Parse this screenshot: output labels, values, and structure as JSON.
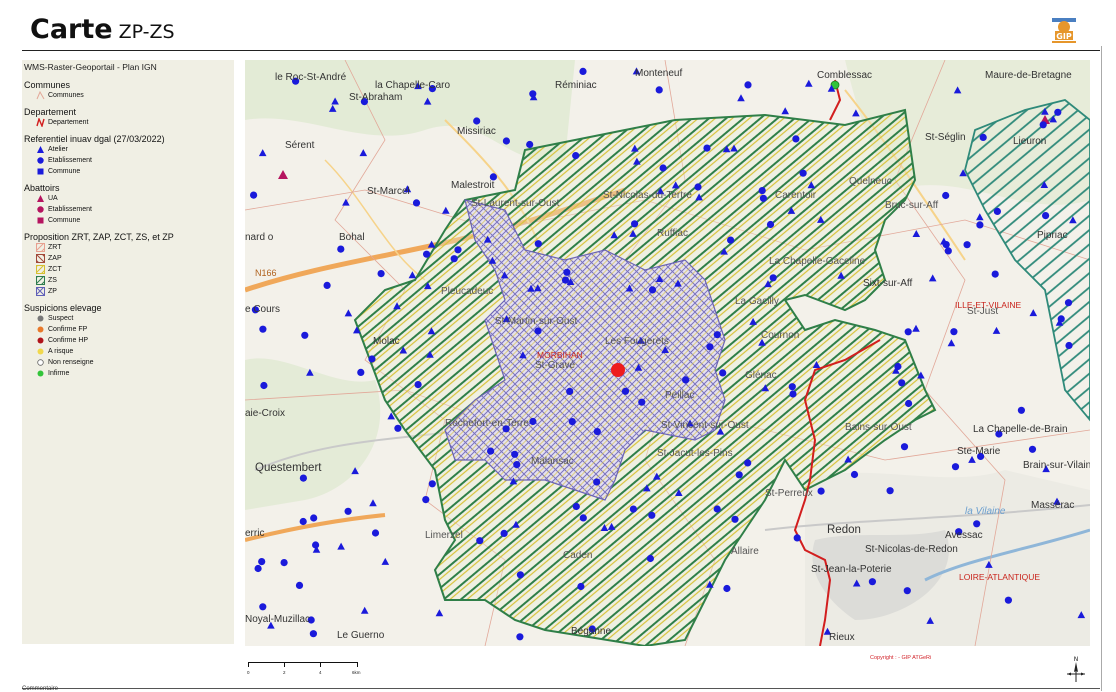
{
  "header": {
    "title": "Carte",
    "subtitle": "ZP-ZS"
  },
  "legend": {
    "basemap": "WMS-Raster-Geoportail - Plan IGN",
    "sections": {
      "communes": {
        "title": "Communes",
        "items": [
          "Communes"
        ]
      },
      "departement": {
        "title": "Departement",
        "items": [
          "Departement"
        ]
      },
      "referentiel": {
        "title": "Referentiel inuav dgal (27/03/2022)",
        "items": [
          "Atelier",
          "Etablissement",
          "Commune"
        ]
      },
      "abattoirs": {
        "title": "Abattoirs",
        "items": [
          "UA",
          "Etablissement",
          "Commune"
        ]
      },
      "proposition": {
        "title": "Proposition ZRT, ZAP, ZCT, ZS, et ZP",
        "items": [
          "ZRT",
          "ZAP",
          "ZCT",
          "ZS",
          "ZP"
        ]
      },
      "suspicions": {
        "title": "Suspicions elevage",
        "items": [
          "Suspect",
          "Confirme FP",
          "Confirme HP",
          "A risque",
          "Non renseigne",
          "Infirme"
        ]
      }
    }
  },
  "map": {
    "places": {
      "le_roc": "le Roc-St-André",
      "la_chapelle_caro": "la Chapelle-Caro",
      "reminiac": "Réminiac",
      "monteneuf": "Monteneuf",
      "comblessac": "Comblessac",
      "maure": "Maure-de-Bretagne",
      "st_abraham": "St-Abraham",
      "missiriac": "Missiriac",
      "serent": "Sérent",
      "st_seglin": "St-Séglin",
      "lieuron": "Lieuron",
      "st_marcel": "St-Marcel",
      "malestroit": "Malestroit",
      "st_nicolas": "St-Nicolas-du-Tertre",
      "carentoir": "Carentoir",
      "quelneuc": "Quelneuc",
      "bruc": "Bruc-sur-Aff",
      "bohal": "Bohal",
      "st_laurent": "St-Laurent-sur-Oust",
      "pipriac": "Pipriac",
      "nardo": "nard o",
      "ruffiac": "Ruffiac",
      "la_chapelle_gaceline": "La Chapelle-Gaceline",
      "sixt": "Sixt-sur-Aff",
      "les_cours": "e Cours",
      "pleucadeuc": "Pleucadeuc",
      "la_gacilly": "La Gacilly",
      "st_martin": "St-Martin-sur-Oust",
      "les_fougerets": "Les Fougerets",
      "cournon": "Cournon",
      "st_just": "St-Just",
      "molac": "Molac",
      "glenac": "Glénac",
      "st_gravé": "St-Gravé",
      "peillac": "Peillac",
      "st_vincent": "St-Vincent-sur-Oust",
      "bains": "Bains-sur-Oust",
      "rochefort": "Rochefort-en-Terre",
      "malansac": "Malansac",
      "st_jacut": "St-Jacut-les-Pins",
      "la_chapelle_brain": "La Chapelle-de-Brain",
      "ste_marie": "Ste-Marie",
      "brain": "Brain-sur-Vilaine",
      "questembert": "Questembert",
      "st_perreux": "St-Perreux",
      "la_vilaine": "la Vilaine",
      "masserac": "Massérac",
      "redon": "Redon",
      "avessac": "Avessac",
      "limerzel": "Limerzel",
      "st_nicolas_redon": "St-Nicolas-de-Redon",
      "caden": "Caden",
      "allaire": "Allaire",
      "st_jean": "St-Jean-la-Poterie",
      "noyal": "Noyal-Muzillac",
      "le_guerno": "Le Guerno",
      "begane": "Béganne",
      "rieux": "Rieux",
      "haie_croix": "aie-Croix",
      "erric": "erric",
      "n166": "N166"
    },
    "regions": {
      "morbihan": "MORBIHAN",
      "ille_et_vilaine": "ILLE-ET-VILAINE",
      "loire_atlantique": "LOIRE-ATLANTIQUE"
    }
  },
  "scale": {
    "ticks": [
      "0",
      "2",
      "4",
      "6km"
    ]
  },
  "copyright": "Copyright : - GIP ATGeRi",
  "footer": {
    "label": "Commentaire"
  }
}
